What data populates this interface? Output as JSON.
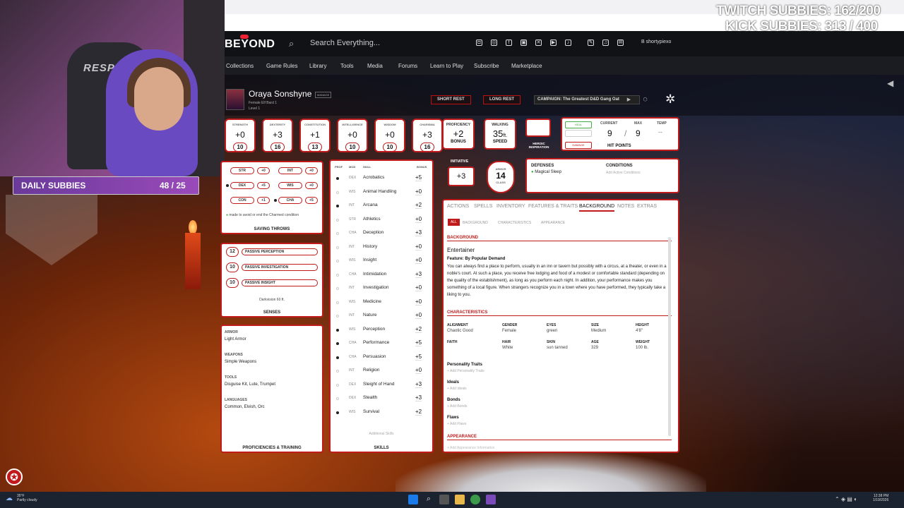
{
  "overlay": {
    "twitch": "TWITCH SUBBIES: 162/200",
    "kick": "KICK SUBBIES: 313 / 400",
    "daily_label": "DAILY SUBBIES",
    "daily_count": "48 / 25",
    "chair_brand": "RESPAWN"
  },
  "site": {
    "logo": "BEYOND",
    "search_placeholder": "Search Everything...",
    "user": "shortypiexo"
  },
  "menu": [
    "Collections",
    "Game Rules",
    "Library",
    "Tools",
    "Media",
    "Forums",
    "Learn to Play",
    "Subscribe",
    "Marketplace"
  ],
  "character": {
    "name": "Oraya Sonshyne",
    "manage": "MANAGE",
    "subtitle": "Female  Elf  Bard 1",
    "level": "Level 1",
    "short_rest": "SHORT REST",
    "long_rest": "LONG REST",
    "campaign": "CAMPAIGN: The Greatest D&D Gang Oat"
  },
  "abilities": [
    {
      "name": "STRENGTH",
      "mod": "+0",
      "score": "10"
    },
    {
      "name": "DEXTERITY",
      "mod": "+3",
      "score": "16"
    },
    {
      "name": "CONSTITUTION",
      "mod": "+1",
      "score": "13"
    },
    {
      "name": "INTELLIGENCE",
      "mod": "+0",
      "score": "10"
    },
    {
      "name": "WISDOM",
      "mod": "+0",
      "score": "10"
    },
    {
      "name": "CHARISMA",
      "mod": "+3",
      "score": "16"
    }
  ],
  "prof": {
    "label": "PROFICIENCY",
    "val": "+2",
    "sub": "BONUS"
  },
  "walk": {
    "label": "WALKING",
    "val": "35",
    "unit": "ft.",
    "sub": "SPEED"
  },
  "heroic": "HEROIC INSPIRATION",
  "hp": {
    "heal": "HEAL",
    "damage": "DAMAGE",
    "current_lbl": "CURRENT",
    "max_lbl": "MAX",
    "temp_lbl": "TEMP",
    "current": "9",
    "max": "9",
    "temp": "--",
    "title": "HIT POINTS"
  },
  "initiative": {
    "label": "INITIATIVE",
    "val": "+3"
  },
  "armor": {
    "label": "ARMOR",
    "val": "14",
    "sub": "CLASS"
  },
  "defenses": {
    "title": "DEFENSES",
    "item": "Magical Sleep",
    "cond_title": "CONDITIONS",
    "cond_add": "Add Active Conditions"
  },
  "saves": [
    {
      "ab": "STR",
      "val": "+0",
      "prof": false
    },
    {
      "ab": "INT",
      "val": "+0",
      "prof": false
    },
    {
      "ab": "DEX",
      "val": "+5",
      "prof": true
    },
    {
      "ab": "WIS",
      "val": "+0",
      "prof": false
    },
    {
      "ab": "CON",
      "val": "+1",
      "prof": false
    },
    {
      "ab": "CHA",
      "val": "+5",
      "prof": true
    }
  ],
  "save_note": "made to avoid or end the Charmed condition",
  "save_title": "SAVING THROWS",
  "passives": [
    {
      "val": "12",
      "label": "PASSIVE PERCEPTION"
    },
    {
      "val": "10",
      "label": "PASSIVE INVESTIGATION"
    },
    {
      "val": "10",
      "label": "PASSIVE INSIGHT"
    }
  ],
  "darkvision": "Darkvision 60 ft.",
  "senses_title": "SENSES",
  "proficiencies": {
    "armor_lbl": "ARMOR",
    "armor": "Light Armor",
    "weapons_lbl": "WEAPONS",
    "weapons": "Simple Weapons",
    "tools_lbl": "TOOLS",
    "tools": "Disguise Kit, Lute, Trumpet",
    "lang_lbl": "LANGUAGES",
    "lang": "Common, Elvish, Orc",
    "title": "PROFICIENCIES & TRAINING"
  },
  "skills_head": {
    "prof": "PROF",
    "mod": "MOD",
    "skill": "SKILL",
    "bonus": "BONUS"
  },
  "skills": [
    {
      "mod": "DEX",
      "name": "Acrobatics",
      "bonus": "+5",
      "prof": true
    },
    {
      "mod": "WIS",
      "name": "Animal Handling",
      "bonus": "+0",
      "prof": false
    },
    {
      "mod": "INT",
      "name": "Arcana",
      "bonus": "+2",
      "prof": true
    },
    {
      "mod": "STR",
      "name": "Athletics",
      "bonus": "+0",
      "prof": false
    },
    {
      "mod": "CHA",
      "name": "Deception",
      "bonus": "+3",
      "prof": false
    },
    {
      "mod": "INT",
      "name": "History",
      "bonus": "+0",
      "prof": false
    },
    {
      "mod": "WIS",
      "name": "Insight",
      "bonus": "+0",
      "prof": false
    },
    {
      "mod": "CHA",
      "name": "Intimidation",
      "bonus": "+3",
      "prof": false
    },
    {
      "mod": "INT",
      "name": "Investigation",
      "bonus": "+0",
      "prof": false
    },
    {
      "mod": "WIS",
      "name": "Medicine",
      "bonus": "+0",
      "prof": false
    },
    {
      "mod": "INT",
      "name": "Nature",
      "bonus": "+0",
      "prof": false
    },
    {
      "mod": "WIS",
      "name": "Perception",
      "bonus": "+2",
      "prof": true
    },
    {
      "mod": "CHA",
      "name": "Performance",
      "bonus": "+5",
      "prof": true
    },
    {
      "mod": "CHA",
      "name": "Persuasion",
      "bonus": "+5",
      "prof": true
    },
    {
      "mod": "INT",
      "name": "Religion",
      "bonus": "+0",
      "prof": false
    },
    {
      "mod": "DEX",
      "name": "Sleight of Hand",
      "bonus": "+3",
      "prof": false
    },
    {
      "mod": "DEX",
      "name": "Stealth",
      "bonus": "+3",
      "prof": false
    },
    {
      "mod": "WIS",
      "name": "Survival",
      "bonus": "+2",
      "prof": true
    }
  ],
  "skills_extra": "Additional Skills",
  "skills_title": "SKILLS",
  "tabs": [
    "ACTIONS",
    "SPELLS",
    "INVENTORY",
    "FEATURES & TRAITS",
    "BACKGROUND",
    "NOTES",
    "EXTRAS"
  ],
  "subtabs": [
    "ALL",
    "BACKGROUND",
    "CHARACTERISTICS",
    "APPEARANCE"
  ],
  "background": {
    "section": "BACKGROUND",
    "name": "Entertainer",
    "feature": "Feature: By Popular Demand",
    "text": "You can always find a place to perform, usually in an inn or tavern but possibly with a circus, at a theater, or even in a noble's court. At such a place, you receive free lodging and food of a modest or comfortable standard (depending on the quality of the establishment), as long as you perform each night. In addition, your performance makes you something of a local figure. When strangers recognize you in a town where you have performed, they typically take a liking to you."
  },
  "characteristics": {
    "title": "CHARACTERISTICS",
    "row1": [
      {
        "l": "ALIGNMENT",
        "v": "Chaotic Good"
      },
      {
        "l": "GENDER",
        "v": "Female"
      },
      {
        "l": "EYES",
        "v": "green"
      },
      {
        "l": "SIZE",
        "v": "Medium"
      },
      {
        "l": "HEIGHT",
        "v": "4'8\""
      }
    ],
    "row2": [
      {
        "l": "FAITH",
        "v": ""
      },
      {
        "l": "HAIR",
        "v": "White"
      },
      {
        "l": "SKIN",
        "v": "sun tanned"
      },
      {
        "l": "AGE",
        "v": "329"
      },
      {
        "l": "WEIGHT",
        "v": "100 lb."
      }
    ]
  },
  "traits": [
    {
      "l": "Personality Traits",
      "a": "+ Add Personality Traits"
    },
    {
      "l": "Ideals",
      "a": "+ Add Ideals"
    },
    {
      "l": "Bonds",
      "a": "+ Add Bonds"
    },
    {
      "l": "Flaws",
      "a": "+ Add Flaws"
    }
  ],
  "appearance": {
    "title": "APPEARANCE",
    "add": "+ Add Appearance Information"
  },
  "taskbar": {
    "temp": "35°F",
    "weather": "Partly cloudy",
    "time": "12:38 PM",
    "date": "1/19/2026"
  },
  "colors": {
    "accent": "#c11a1a",
    "sheet_bg": "#ffffff",
    "nav_bg": "#111216"
  }
}
